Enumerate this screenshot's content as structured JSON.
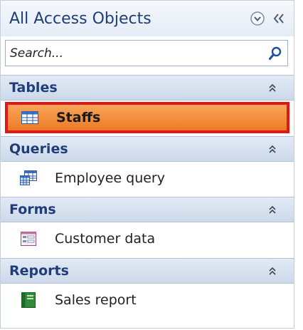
{
  "pane": {
    "title": "All Access Objects",
    "menu_icon": "circle-chevron-down-icon",
    "collapse_icon": "double-chevron-left-icon"
  },
  "search": {
    "placeholder": "Search...",
    "value": ""
  },
  "groups": [
    {
      "label": "Tables",
      "items": [
        {
          "label": "Staffs",
          "icon": "table-icon",
          "selected": true
        }
      ]
    },
    {
      "label": "Queries",
      "items": [
        {
          "label": "Employee query",
          "icon": "query-icon",
          "selected": false
        }
      ]
    },
    {
      "label": "Forms",
      "items": [
        {
          "label": "Customer data",
          "icon": "form-icon",
          "selected": false
        }
      ]
    },
    {
      "label": "Reports",
      "items": [
        {
          "label": "Sales report",
          "icon": "report-icon",
          "selected": false
        }
      ]
    }
  ],
  "colors": {
    "title": "#1f3d7a",
    "selected_fill": "#ec7a25",
    "selected_border": "#e01818"
  }
}
